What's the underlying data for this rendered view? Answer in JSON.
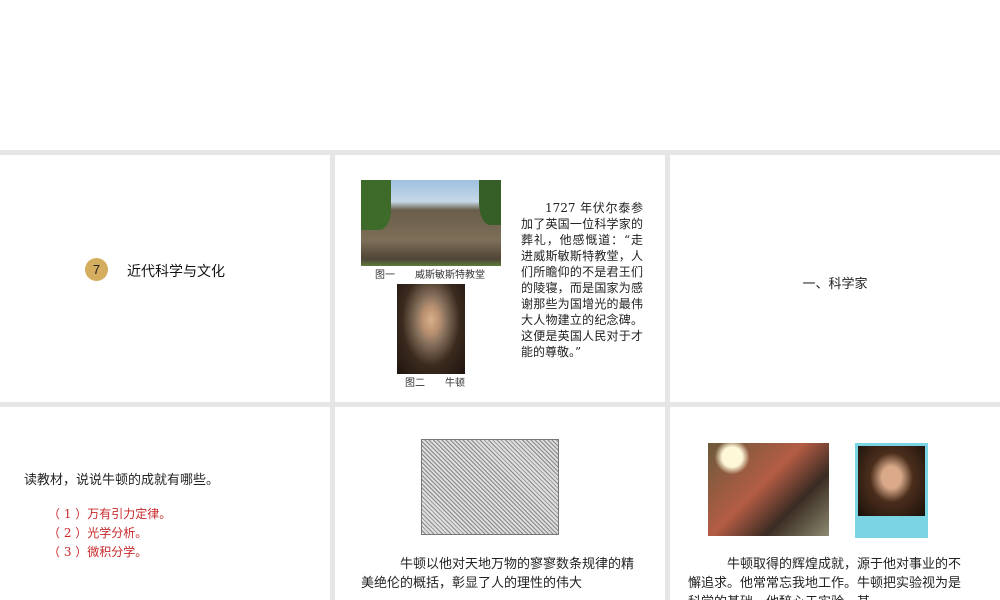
{
  "slide1": {
    "badge": "7",
    "lesson_title": "近代科学与文化"
  },
  "slide2": {
    "caption1": "图一　　威斯敏斯特教堂",
    "caption2": "图二　　牛顿",
    "quote": "1727 年伏尔泰参加了英国一位科学家的葬礼，他感慨道：“走进威斯敏斯特教堂，人们所瞻仰的不是君王们的陵寝，而是国家为感谢那些为国增光的最伟大人物建立的纪念碑。这便是英国人民对于才能的尊敬。”"
  },
  "slide3": {
    "heading": "一、科学家"
  },
  "slide4": {
    "question": "读教材，说说牛顿的成就有哪些。",
    "answers": [
      "（ 1 ）万有引力定律。",
      "（ 2 ）光学分析。",
      "（ 3 ）微积分学。"
    ]
  },
  "slide5": {
    "paragraph": "牛顿以他对天地万物的寥寥数条规律的精美绝伦的概括，彰显了人的理性的伟大"
  },
  "slide6": {
    "paragraph": "牛顿取得的辉煌成就，源于他对事业的不懈追求。他常常忘我地工作。牛顿把实验视为是科学的基础，他醉心于实验，甚"
  },
  "colors": {
    "badge": "#d5ad5f",
    "answer": "#c8282a",
    "gap": "#e6e6e6"
  }
}
